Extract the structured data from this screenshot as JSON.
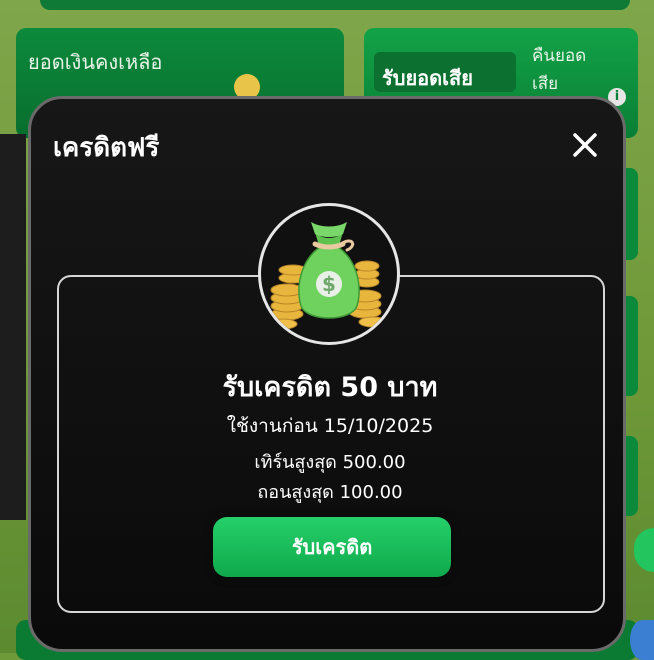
{
  "background": {
    "balance_label": "ยอดเงินคงเหลือ",
    "loss_pill_label": "รับยอดเสีย",
    "loss_side_label": "คืนยอดเสีย",
    "info_glyph": "i"
  },
  "modal": {
    "title": "เครดิตฟรี",
    "close_icon": "close-icon",
    "credit_title": "รับเครดิต 50 บาท",
    "expire_text": "ใช้งานก่อน 15/10/2025",
    "turnover_text": "เทิร์นสูงสุด 500.00",
    "withdraw_text": "ถอนสูงสุด 100.00",
    "claim_button": "รับเครดิต",
    "illustration_icon": "money-bag-icon"
  },
  "colors": {
    "accent_green": "#22c55e",
    "modal_bg": "#111111",
    "text": "#ffffff"
  }
}
